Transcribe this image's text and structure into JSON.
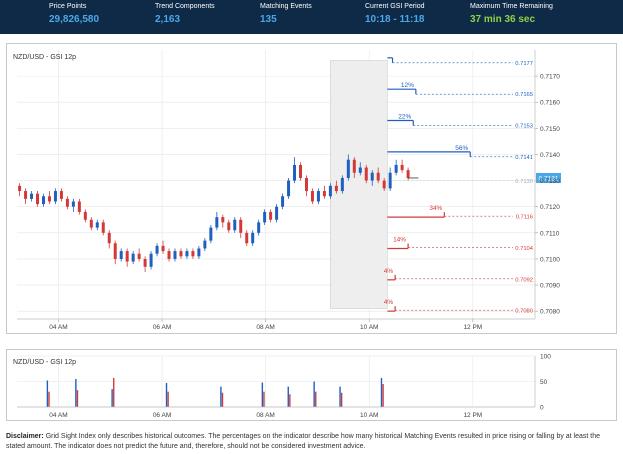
{
  "header": {
    "metrics": [
      {
        "label": "Price Points",
        "value": "29,826,580"
      },
      {
        "label": "Trend Components",
        "value": "2,163"
      },
      {
        "label": "Matching Events",
        "value": "135"
      },
      {
        "label": "Current GSI Period",
        "value": "10:18 - 11:18"
      },
      {
        "label": "Maximum Time Remaining",
        "value": "37 min 36 sec"
      }
    ]
  },
  "chart": {
    "title": "NZD/USD - GSI 12p",
    "current_price": "0.7131",
    "colors": {
      "up": "#1f5fbf",
      "down": "#d23a3a",
      "grid": "#e6e6e6",
      "highlight": "#eeeeee"
    },
    "y_labels": [
      "0.7170",
      "0.7160",
      "0.7150",
      "0.7140",
      "0.7130",
      "0.7120",
      "0.7110",
      "0.7100",
      "0.7090",
      "0.7080"
    ],
    "x_labels": [
      "04 AM",
      "06 AM",
      "08 AM",
      "10 AM",
      "12 PM"
    ],
    "up_levels": [
      {
        "pct": "",
        "price": "0.7177"
      },
      {
        "pct": "12%",
        "price": "0.7165"
      },
      {
        "pct": "22%",
        "price": "0.7153"
      },
      {
        "pct": "56%",
        "price": "0.7141"
      }
    ],
    "mid_price": "0.7130",
    "down_levels": [
      {
        "pct": "34%",
        "price": "0.7116"
      },
      {
        "pct": "14%",
        "price": "0.7104"
      },
      {
        "pct": "4%",
        "price": "0.7092"
      },
      {
        "pct": "4%",
        "price": "0.7080"
      }
    ],
    "candles": [
      {
        "o": 7128.0,
        "c": 7126.0,
        "h": 7129.0,
        "l": 7124.0
      },
      {
        "o": 7126.0,
        "c": 7123.0,
        "h": 7127.0,
        "l": 7121.0
      },
      {
        "o": 7123.0,
        "c": 7125.0,
        "h": 7126.0,
        "l": 7122.0
      },
      {
        "o": 7125.0,
        "c": 7121.0,
        "h": 7126.0,
        "l": 7120.0
      },
      {
        "o": 7121.0,
        "c": 7124.0,
        "h": 7125.0,
        "l": 7120.0
      },
      {
        "o": 7124.0,
        "c": 7122.0,
        "h": 7126.0,
        "l": 7121.0
      },
      {
        "o": 7122.0,
        "c": 7126.0,
        "h": 7127.0,
        "l": 7121.0
      },
      {
        "o": 7126.0,
        "c": 7123.0,
        "h": 7127.0,
        "l": 7122.0
      },
      {
        "o": 7123.0,
        "c": 7120.0,
        "h": 7124.0,
        "l": 7119.0
      },
      {
        "o": 7120.0,
        "c": 7122.0,
        "h": 7123.0,
        "l": 7118.0
      },
      {
        "o": 7122.0,
        "c": 7118.0,
        "h": 7123.0,
        "l": 7117.0
      },
      {
        "o": 7118.0,
        "c": 7115.0,
        "h": 7119.0,
        "l": 7114.0
      },
      {
        "o": 7115.0,
        "c": 7112.0,
        "h": 7116.0,
        "l": 7111.0
      },
      {
        "o": 7112.0,
        "c": 7114.0,
        "h": 7115.0,
        "l": 7111.0
      },
      {
        "o": 7114.0,
        "c": 7110.0,
        "h": 7115.0,
        "l": 7109.0
      },
      {
        "o": 7110.0,
        "c": 7106.0,
        "h": 7111.0,
        "l": 7104.0
      },
      {
        "o": 7106.0,
        "c": 7100.0,
        "h": 7107.0,
        "l": 7098.0
      },
      {
        "o": 7100.0,
        "c": 7103.0,
        "h": 7104.0,
        "l": 7099.0
      },
      {
        "o": 7103.0,
        "c": 7099.0,
        "h": 7104.0,
        "l": 7097.0
      },
      {
        "o": 7099.0,
        "c": 7102.0,
        "h": 7103.0,
        "l": 7098.0
      },
      {
        "o": 7102.0,
        "c": 7100.0,
        "h": 7104.0,
        "l": 7099.0
      },
      {
        "o": 7100.0,
        "c": 7097.0,
        "h": 7101.0,
        "l": 7095.0
      },
      {
        "o": 7097.0,
        "c": 7102.0,
        "h": 7103.0,
        "l": 7096.0
      },
      {
        "o": 7102.0,
        "c": 7105.0,
        "h": 7106.0,
        "l": 7101.0
      },
      {
        "o": 7105.0,
        "c": 7103.0,
        "h": 7107.0,
        "l": 7102.0
      },
      {
        "o": 7103.0,
        "c": 7100.0,
        "h": 7104.0,
        "l": 7099.0
      },
      {
        "o": 7100.0,
        "c": 7103.0,
        "h": 7104.0,
        "l": 7099.0
      },
      {
        "o": 7103.0,
        "c": 7101.0,
        "h": 7104.0,
        "l": 7100.0
      },
      {
        "o": 7101.0,
        "c": 7103.0,
        "h": 7104.0,
        "l": 7100.0
      },
      {
        "o": 7103.0,
        "c": 7101.0,
        "h": 7104.0,
        "l": 7100.0
      },
      {
        "o": 7101.0,
        "c": 7104.0,
        "h": 7105.0,
        "l": 7100.0
      },
      {
        "o": 7104.0,
        "c": 7107.0,
        "h": 7108.0,
        "l": 7103.0
      },
      {
        "o": 7107.0,
        "c": 7112.0,
        "h": 7113.0,
        "l": 7106.0
      },
      {
        "o": 7112.0,
        "c": 7116.0,
        "h": 7118.0,
        "l": 7111.0
      },
      {
        "o": 7116.0,
        "c": 7114.0,
        "h": 7117.0,
        "l": 7112.0
      },
      {
        "o": 7114.0,
        "c": 7111.0,
        "h": 7115.0,
        "l": 7110.0
      },
      {
        "o": 7111.0,
        "c": 7115.0,
        "h": 7116.0,
        "l": 7110.0
      },
      {
        "o": 7115.0,
        "c": 7110.0,
        "h": 7116.0,
        "l": 7108.0
      },
      {
        "o": 7110.0,
        "c": 7106.0,
        "h": 7111.0,
        "l": 7105.0
      },
      {
        "o": 7106.0,
        "c": 7110.0,
        "h": 7111.0,
        "l": 7105.0
      },
      {
        "o": 7110.0,
        "c": 7114.0,
        "h": 7115.0,
        "l": 7109.0
      },
      {
        "o": 7114.0,
        "c": 7118.0,
        "h": 7119.0,
        "l": 7113.0
      },
      {
        "o": 7118.0,
        "c": 7115.0,
        "h": 7119.0,
        "l": 7114.0
      },
      {
        "o": 7115.0,
        "c": 7120.0,
        "h": 7121.0,
        "l": 7114.0
      },
      {
        "o": 7120.0,
        "c": 7124.0,
        "h": 7125.0,
        "l": 7119.0
      },
      {
        "o": 7124.0,
        "c": 7130.0,
        "h": 7131.0,
        "l": 7123.0
      },
      {
        "o": 7130.0,
        "c": 7136.0,
        "h": 7139.0,
        "l": 7129.0
      },
      {
        "o": 7136.0,
        "c": 7131.0,
        "h": 7137.0,
        "l": 7130.0
      },
      {
        "o": 7131.0,
        "c": 7126.0,
        "h": 7132.0,
        "l": 7124.0
      },
      {
        "o": 7126.0,
        "c": 7122.0,
        "h": 7127.0,
        "l": 7121.0
      },
      {
        "o": 7122.0,
        "c": 7126.0,
        "h": 7127.0,
        "l": 7121.0
      },
      {
        "o": 7126.0,
        "c": 7124.0,
        "h": 7128.0,
        "l": 7123.0
      },
      {
        "o": 7124.0,
        "c": 7128.0,
        "h": 7129.0,
        "l": 7123.0
      },
      {
        "o": 7128.0,
        "c": 7126.0,
        "h": 7130.0,
        "l": 7125.0
      },
      {
        "o": 7126.0,
        "c": 7131.0,
        "h": 7132.0,
        "l": 7125.0
      },
      {
        "o": 7131.0,
        "c": 7138.0,
        "h": 7140.0,
        "l": 7130.0
      },
      {
        "o": 7138.0,
        "c": 7133.0,
        "h": 7139.0,
        "l": 7131.0
      },
      {
        "o": 7133.0,
        "c": 7135.0,
        "h": 7137.0,
        "l": 7132.0
      },
      {
        "o": 7135.0,
        "c": 7130.0,
        "h": 7136.0,
        "l": 7129.0
      },
      {
        "o": 7130.0,
        "c": 7133.0,
        "h": 7134.0,
        "l": 7128.0
      },
      {
        "o": 7133.0,
        "c": 7130.0,
        "h": 7135.0,
        "l": 7129.0
      },
      {
        "o": 7130.0,
        "c": 7127.0,
        "h": 7131.0,
        "l": 7126.0
      },
      {
        "o": 7127.0,
        "c": 7133.0,
        "h": 7135.0,
        "l": 7126.0
      },
      {
        "o": 7133.0,
        "c": 7136.0,
        "h": 7138.0,
        "l": 7132.0
      },
      {
        "o": 7136.0,
        "c": 7134.0,
        "h": 7138.0,
        "l": 7133.0
      },
      {
        "o": 7134.0,
        "c": 7131.0,
        "h": 7135.0,
        "l": 7130.0
      }
    ]
  },
  "volume": {
    "title": "NZD/USD - GSI 12p",
    "y_labels": [
      "100",
      "50",
      "0"
    ],
    "x_labels": [
      "04 AM",
      "06 AM",
      "08 AM",
      "10 AM",
      "12 PM"
    ],
    "bars": [
      {
        "time": 3.8,
        "blue": 52,
        "red": 30
      },
      {
        "time": 4.35,
        "blue": 55,
        "red": 33
      },
      {
        "time": 5.05,
        "blue": 35,
        "red": 57
      },
      {
        "time": 6.1,
        "blue": 47,
        "red": 30
      },
      {
        "time": 7.15,
        "blue": 40,
        "red": 28
      },
      {
        "time": 7.95,
        "blue": 48,
        "red": 30
      },
      {
        "time": 8.45,
        "blue": 40,
        "red": 25
      },
      {
        "time": 8.95,
        "blue": 50,
        "red": 30
      },
      {
        "time": 9.45,
        "blue": 40,
        "red": 28
      },
      {
        "time": 10.25,
        "blue": 57,
        "red": 45
      }
    ]
  },
  "disclaimer": {
    "label": "Disclaimer:",
    "text": "Grid Sight Index only describes historical outcomes. The percentages on the indicator describe how many historical Matching Events resulted in price rising or falling by at least the stated amount. The indicator does not predict the future and, therefore, should not be considered investment advice."
  }
}
